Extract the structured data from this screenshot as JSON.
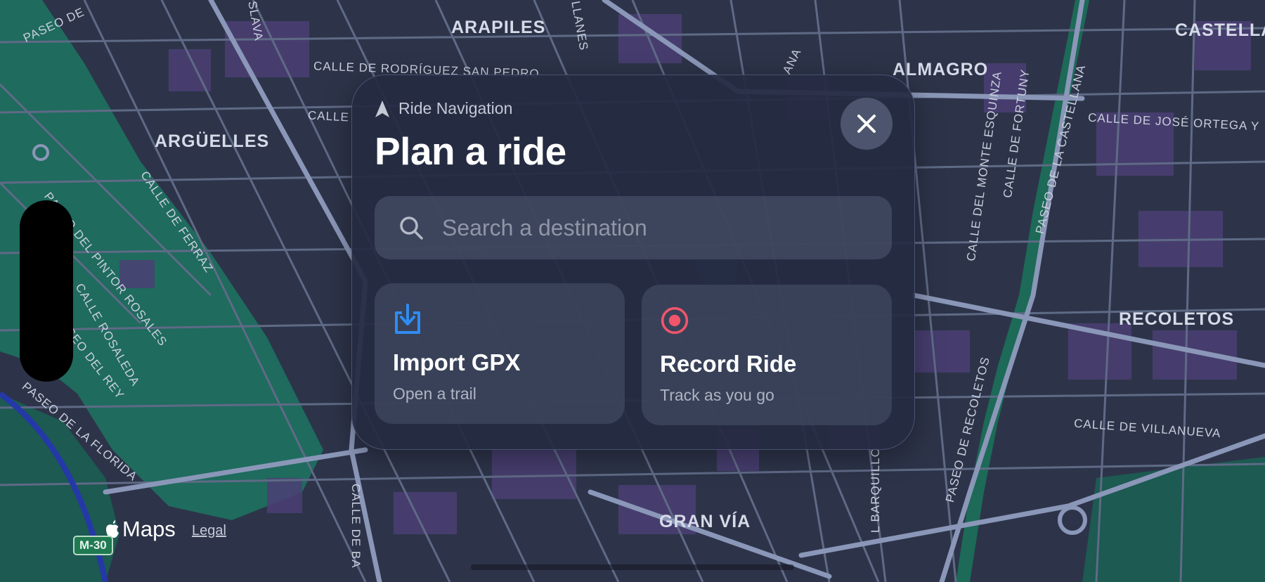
{
  "map": {
    "districts": [
      "ARAPILES",
      "ALMAGRO",
      "CASTELLAN",
      "ARGÜELLES",
      "RECOLETOS",
      "GRAN VÍA"
    ],
    "streets": [
      "PASEO DE",
      "CALLE DE RODRÍGUEZ SAN PEDRO",
      "CALLE",
      "PASEO DEL PINTOR ROSALES",
      "CALLE DE FERRAZ",
      "CALLE ROSALEDA",
      "PASEO DEL REY",
      "PASEO DE LA FLORIDA",
      "CALLE DE JOSÉ ORTEGA Y",
      "CALLE DEL MONTE ESQUINZA",
      "CALLE DE FORTUNY",
      "PASEO DE LA CASTELLANA",
      "CALLE DE VILLANUEVA",
      "PASEO DE RECOLETOS",
      "L BARQUILLO",
      "CALLE DE BA",
      "LLANES",
      "SLAVA",
      "ANA"
    ]
  },
  "panel": {
    "subtitle": "Ride Navigation",
    "title": "Plan a ride",
    "close_icon": "close-icon",
    "search": {
      "placeholder": "Search a destination",
      "icon": "search-icon"
    },
    "cards": [
      {
        "title": "Import GPX",
        "subtitle": "Open a trail",
        "icon": "import-icon",
        "color": "#2f8cf2"
      },
      {
        "title": "Record Ride",
        "subtitle": "Track as you go",
        "icon": "record-icon",
        "color": "#f0556a"
      }
    ]
  },
  "footer": {
    "maps_label": "Maps",
    "legal_label": "Legal",
    "road_shield": "M-30"
  }
}
